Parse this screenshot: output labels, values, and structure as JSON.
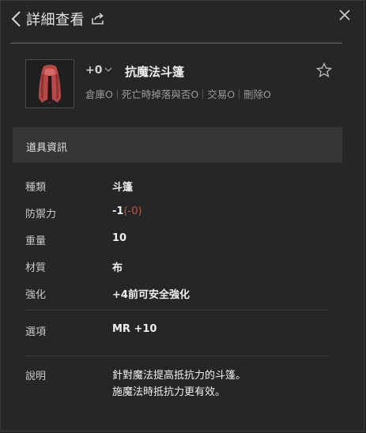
{
  "header": {
    "title": "詳細查看"
  },
  "item": {
    "enhance": "+0",
    "name": "抗魔法斗篷",
    "flags": [
      "倉庫O",
      "死亡時掉落與否O",
      "交易O",
      "刪除O"
    ]
  },
  "section": {
    "title": "道具資訊"
  },
  "props": {
    "type": {
      "key": "種類",
      "value": "斗篷"
    },
    "defense": {
      "key": "防禦力",
      "value": "-1",
      "extra": "(-0)"
    },
    "weight": {
      "key": "重量",
      "value": "10"
    },
    "material": {
      "key": "材質",
      "value": "布"
    },
    "enchant": {
      "key": "強化",
      "value": "+4前可安全強化"
    },
    "option": {
      "key": "選項",
      "value": "MR +10"
    },
    "desc": {
      "key": "說明",
      "line1": "針對魔法提高抵抗力的斗篷。",
      "line2": "施魔法時抵抗力更有效。"
    }
  },
  "colors": {
    "background": "#262626",
    "section": "#353535",
    "negative": "#c0584a",
    "cloak": "#b8484a"
  },
  "icons": [
    "back-icon",
    "share-icon",
    "close-icon",
    "chevron-down-icon",
    "star-icon",
    "cloak-icon"
  ]
}
